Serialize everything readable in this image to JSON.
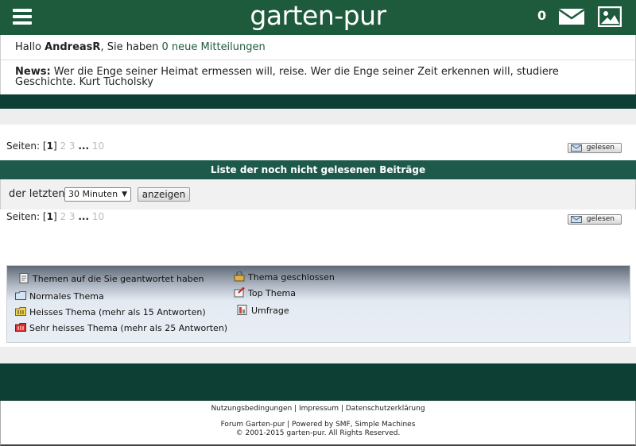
{
  "header": {
    "site_title": "garten-pur",
    "message_count": "0",
    "background_color": "#1e5a3c"
  },
  "welcome": {
    "prefix": "Hallo ",
    "username": "AndreasR",
    "middle": ", Sie haben ",
    "messages_link": "0 neue Mitteilungen"
  },
  "news": {
    "label": "News:",
    "text": " Wer die Enge seiner Heimat ermessen will, reise. Wer die Enge seiner Zeit erkennen will, studiere Geschichte. Kurt Tucholsky"
  },
  "pagination": {
    "label": "Seiten: ",
    "current": "1",
    "pages": [
      "2",
      "3"
    ],
    "ellipsis": "...",
    "last": "10"
  },
  "mark_read_button": "gelesen",
  "section": {
    "title": "Liste der noch nicht gelesenen Beiträge"
  },
  "filter": {
    "label": "der letzten",
    "selected": "30 Minuten",
    "show_button": "anzeigen"
  },
  "legend": {
    "items": [
      {
        "icon": "replied-topic-icon",
        "label": "Themen auf die Sie geantwortet haben"
      },
      {
        "icon": "normal-topic-icon",
        "label": "Normales Thema"
      },
      {
        "icon": "hot-topic-icon",
        "label": "Heisses Thema (mehr als 15 Antworten)"
      },
      {
        "icon": "very-hot-topic-icon",
        "label": "Sehr heisses Thema (mehr als 25 Antworten)"
      },
      {
        "icon": "locked-topic-icon",
        "label": "Thema geschlossen"
      },
      {
        "icon": "sticky-topic-icon",
        "label": "Top Thema"
      },
      {
        "icon": "poll-icon",
        "label": "Umfrage"
      }
    ]
  },
  "footer": {
    "links": [
      "Nutzungsbedingungen",
      "Impressum",
      "Datenschutzerklärung"
    ],
    "separator": " | ",
    "powered": "Forum Garten-pur | Powered by SMF, Simple Machines",
    "copyright": "© 2001-2015 garten-pur. All Rights Reserved."
  }
}
